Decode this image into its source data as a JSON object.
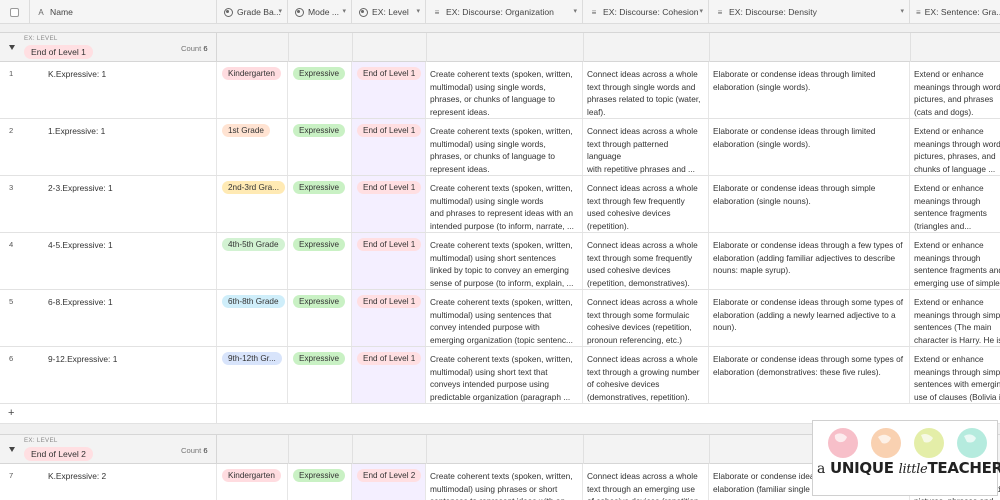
{
  "columns": [
    {
      "label": "Name",
      "icon": "text-icon"
    },
    {
      "label": "Grade Ba...",
      "icon": "single-select-icon"
    },
    {
      "label": "Mode ...",
      "icon": "single-select-icon"
    },
    {
      "label": "EX: Level",
      "icon": "single-select-icon"
    },
    {
      "label": "EX: Discourse: Organization",
      "icon": "long-text-icon"
    },
    {
      "label": "EX: Discourse: Cohesion",
      "icon": "long-text-icon"
    },
    {
      "label": "EX: Discourse: Density",
      "icon": "long-text-icon"
    },
    {
      "label": "EX: Sentence: Gra...",
      "icon": "long-text-icon"
    }
  ],
  "groups": [
    {
      "key_label": "EX: LEVEL",
      "value": "End of Level 1",
      "count_label": "Count",
      "count": "6",
      "rows": [
        {
          "num": "1",
          "name": "K.Expressive: 1",
          "grade": "Kindergarten",
          "grade_color": "#ffdce0",
          "mode": "Expressive",
          "level": "End of Level 1",
          "org": "Create coherent texts (spoken, written,\nmultimodal) using single words,\nphrases, or chunks of language to\nrepresent ideas.",
          "coh": "Connect ideas across a whole\ntext through single words and\nphrases related to topic (water,\nleaf).",
          "den": "Elaborate or condense ideas through limited\nelaboration (single words).",
          "sen": "Extend or enhance\nmeanings through words,\npictures, and phrases\n(cats and dogs)."
        },
        {
          "num": "2",
          "name": "1.Expressive: 1",
          "grade": "1st Grade",
          "grade_color": "#ffe3d2",
          "mode": "Expressive",
          "level": "End of Level 1",
          "org": "Create coherent texts (spoken, written,\nmultimodal) using single words,\nphrases, or chunks of language to\nrepresent ideas.",
          "coh": "Connect ideas across a whole\ntext through patterned\nlanguage\nwith repetitive phrases and ...",
          "den": "Elaborate or condense ideas through limited\nelaboration (single words).",
          "sen": "Extend or enhance\nmeanings through words,\npictures, phrases, and\nchunks of language ..."
        },
        {
          "num": "3",
          "name": "2-3.Expressive: 1",
          "grade": "2nd-3rd Gra...",
          "grade_color": "#ffeab4",
          "mode": "Expressive",
          "level": "End of Level 1",
          "org": "Create coherent texts (spoken, written,\nmultimodal) using single words\nand phrases to represent ideas with an\nintended purpose (to inform, narrate, ...",
          "coh": "Connect ideas across a whole\ntext through few frequently\nused cohesive devices\n(repetition).",
          "den": "Elaborate or condense ideas through simple\nelaboration (single nouns).",
          "sen": "Extend or enhance\nmeanings through\nsentence fragments\n(triangles and..."
        },
        {
          "num": "4",
          "name": "4-5.Expressive: 1",
          "grade": "4th-5th Grade",
          "grade_color": "#d2f2d2",
          "mode": "Expressive",
          "level": "End of Level 1",
          "org": "Create coherent texts (spoken, written,\nmultimodal) using short sentences\nlinked by topic to convey an emerging\nsense of purpose (to inform, explain, ...",
          "coh": "Connect ideas across a whole\ntext through some frequently\nused cohesive devices\n(repetition, demonstratives).",
          "den": "Elaborate or condense ideas through a few types of\nelaboration (adding familiar adjectives to describe\nnouns: maple syrup).",
          "sen": "Extend or enhance\nmeanings through\nsentence fragments and\nemerging use of simple"
        },
        {
          "num": "5",
          "name": "6-8.Expressive: 1",
          "grade": "6th-8th Grade",
          "grade_color": "#cfeefa",
          "mode": "Expressive",
          "level": "End of Level 1",
          "org": "Create coherent texts (spoken, written,\nmultimodal) using sentences that\nconvey intended purpose with\nemerging organization (topic sentenc...",
          "coh": "Connect ideas across a whole\ntext through some formulaic\ncohesive devices (repetition,\npronoun referencing, etc.)",
          "den": "Elaborate or condense ideas through some types of\nelaboration (adding a newly learned adjective to a\nnoun).",
          "sen": "Extend or enhance\nmeanings through simple\nsentences (The main\ncharacter is Harry. He is"
        },
        {
          "num": "6",
          "name": "9-12.Expressive: 1",
          "grade": "9th-12th Gr...",
          "grade_color": "#d8e4fb",
          "mode": "Expressive",
          "level": "End of Level 1",
          "org": "Create coherent texts (spoken, written,\nmultimodal) using short text that\nconveys intended purpose using\npredictable organization (paragraph ...",
          "coh": "Connect ideas across a whole\ntext through a growing number\nof cohesive devices\n(demonstratives, repetition).",
          "den": "Elaborate or condense ideas through some types of\nelaboration (demonstratives: these five rules).",
          "sen": "Extend or enhance\nmeanings through simple\nsentences with emerging\nuse of clauses (Bolivia is"
        }
      ]
    },
    {
      "key_label": "EX: LEVEL",
      "value": "End of Level  2",
      "count_label": "Count",
      "count": "6",
      "rows": [
        {
          "num": "7",
          "name": "K.Expressive: 2",
          "grade": "Kindergarten",
          "grade_color": "#ffdce0",
          "mode": "Expressive",
          "level": "End of Level  2",
          "org": "Create coherent texts (spoken, written,\nmultimodal) using phrases or short\nsentences to represent ideas with an",
          "coh": "Connect ideas across a whole\ntext through an emerging use\nof cohesive devices (repetition,",
          "den": "Elaborate or condense ideas through simple\nelaboration (familiar single nouns).",
          "sen": "Extend or enhance\nmeanings through words,\npictures, phrases and"
        }
      ]
    }
  ],
  "add_row_symbol": "+",
  "logo": {
    "a": "a",
    "unique": "UNIQUE",
    "little": "little",
    "teacher": "TEACHER"
  },
  "colors": {
    "expressive_pill": "#c9f1c4",
    "level_pill": "#ffdfe2",
    "level_column_bg": "#f4efff"
  }
}
